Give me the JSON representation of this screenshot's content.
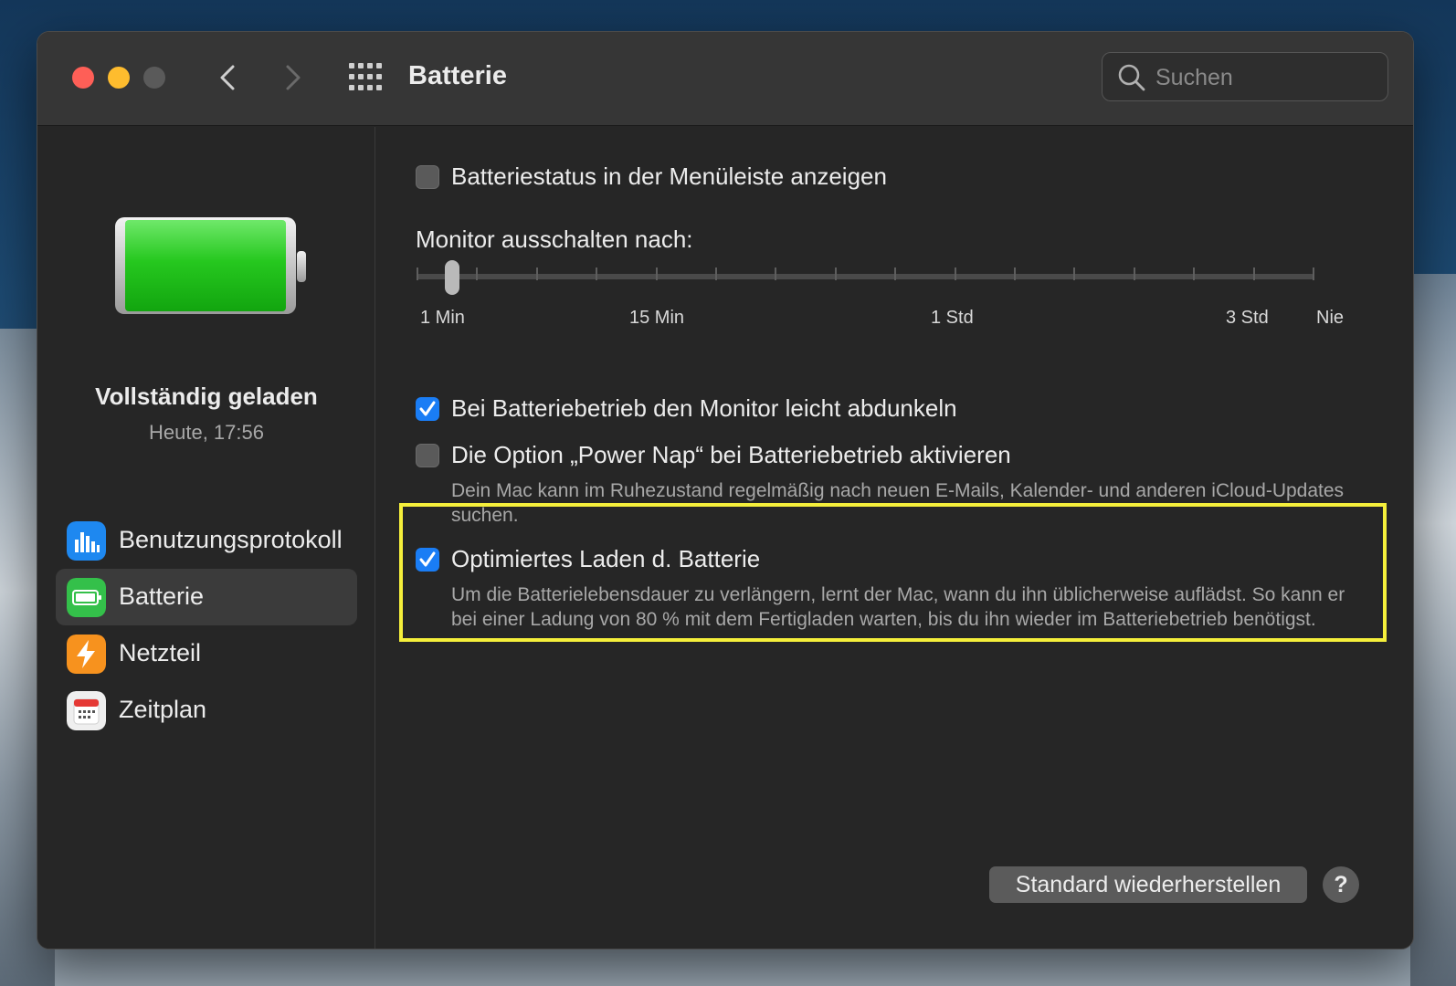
{
  "window": {
    "title": "Batterie"
  },
  "search": {
    "placeholder": "Suchen"
  },
  "sidebar": {
    "status_title": "Vollständig geladen",
    "status_time": "Heute, 17:56",
    "items": [
      {
        "label": "Benutzungsprotokoll",
        "icon": "bar-chart-icon",
        "selected": false
      },
      {
        "label": "Batterie",
        "icon": "battery-icon",
        "selected": true
      },
      {
        "label": "Netzteil",
        "icon": "lightning-icon",
        "selected": false
      },
      {
        "label": "Zeitplan",
        "icon": "calendar-icon",
        "selected": false
      }
    ]
  },
  "settings": {
    "show_status": {
      "label": "Batteriestatus in der Menüleiste anzeigen",
      "checked": false
    },
    "display_off": {
      "label": "Monitor ausschalten nach:",
      "tick_labels": [
        "1 Min",
        "15 Min",
        "1 Std",
        "3 Std",
        "Nie"
      ],
      "value": "1 Min",
      "position_fraction": 0.04
    },
    "dim_display": {
      "label": "Bei Batteriebetrieb den Monitor leicht abdunkeln",
      "checked": true
    },
    "power_nap": {
      "label": "Die Option „Power Nap“ bei Batteriebetrieb aktivieren",
      "description": "Dein Mac kann im Ruhezustand regelmäßig nach neuen E-Mails, Kalender- und anderen iCloud-Updates suchen.",
      "checked": false
    },
    "optimized_charging": {
      "label": "Optimiertes Laden d. Batterie",
      "description": "Um die Batterielebensdauer zu verlängern, lernt der Mac, wann du ihn üblicherweise auflädst. So kann er bei einer Ladung von 80 % mit dem Fertigladen warten, bis du ihn wieder im Batteriebetrieb benötigst.",
      "checked": true
    }
  },
  "buttons": {
    "restore_defaults": "Standard wiederherstellen",
    "help": "?"
  },
  "colors": {
    "accent": "#1a7df5",
    "highlight": "#f5ef3b",
    "battery_green": "#22c51e"
  }
}
